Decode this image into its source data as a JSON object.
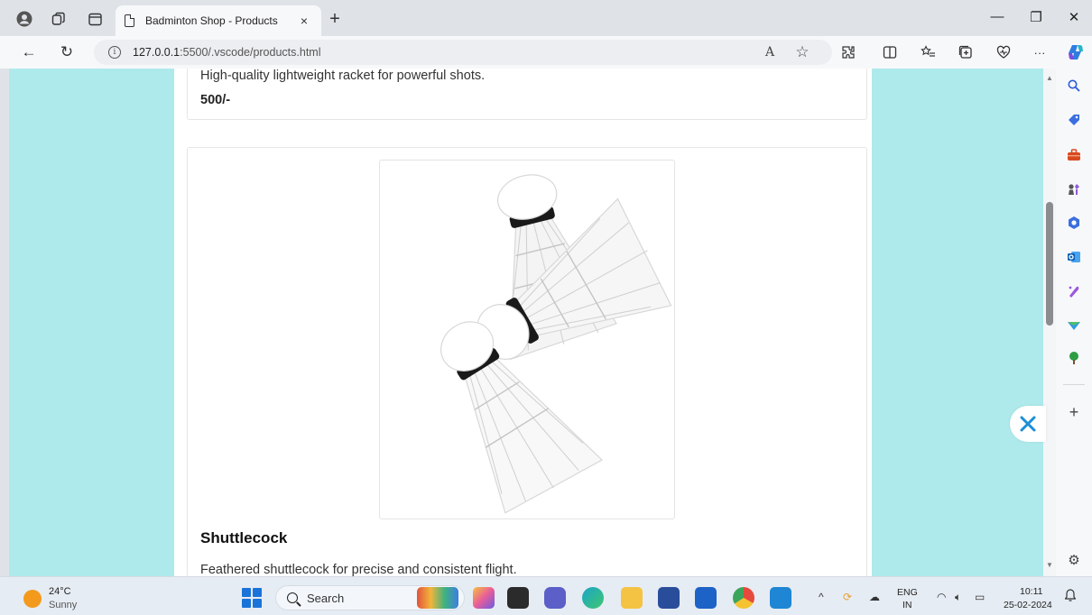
{
  "browser": {
    "tab_title": "Badminton Shop - Products",
    "tab_close": "×",
    "new_tab": "+",
    "address": {
      "url_host": "127.0.0.1",
      "url_rest": ":5500/.vscode/products.html",
      "info_glyph": "i"
    },
    "window_controls": {
      "minimize": "—",
      "restore": "❐",
      "close": "✕"
    },
    "nav": {
      "back": "←",
      "refresh": "↻"
    },
    "toolbar": {
      "read_aloud": "A",
      "favorite": "☆",
      "more": "···"
    }
  },
  "page": {
    "products": [
      {
        "description": "High-quality lightweight racket for powerful shots.",
        "price": "500/-"
      },
      {
        "name": "Shuttlecock",
        "description": "Feathered shuttlecock for precise and consistent flight."
      }
    ]
  },
  "sidebar": {
    "add": "+",
    "settings": "⚙"
  },
  "taskbar": {
    "weather": {
      "temp": "24°C",
      "condition": "Sunny"
    },
    "search_label": "Search",
    "tray": {
      "lang_top": "ENG",
      "lang_bottom": "IN",
      "time": "10:11",
      "date": "25-02-2024",
      "chevron": "^"
    }
  },
  "colors": {
    "page_background": "#aeeaec",
    "container_background": "#ffffff",
    "taskbar": "#e6ecf3",
    "accent": "#1a73d9"
  }
}
